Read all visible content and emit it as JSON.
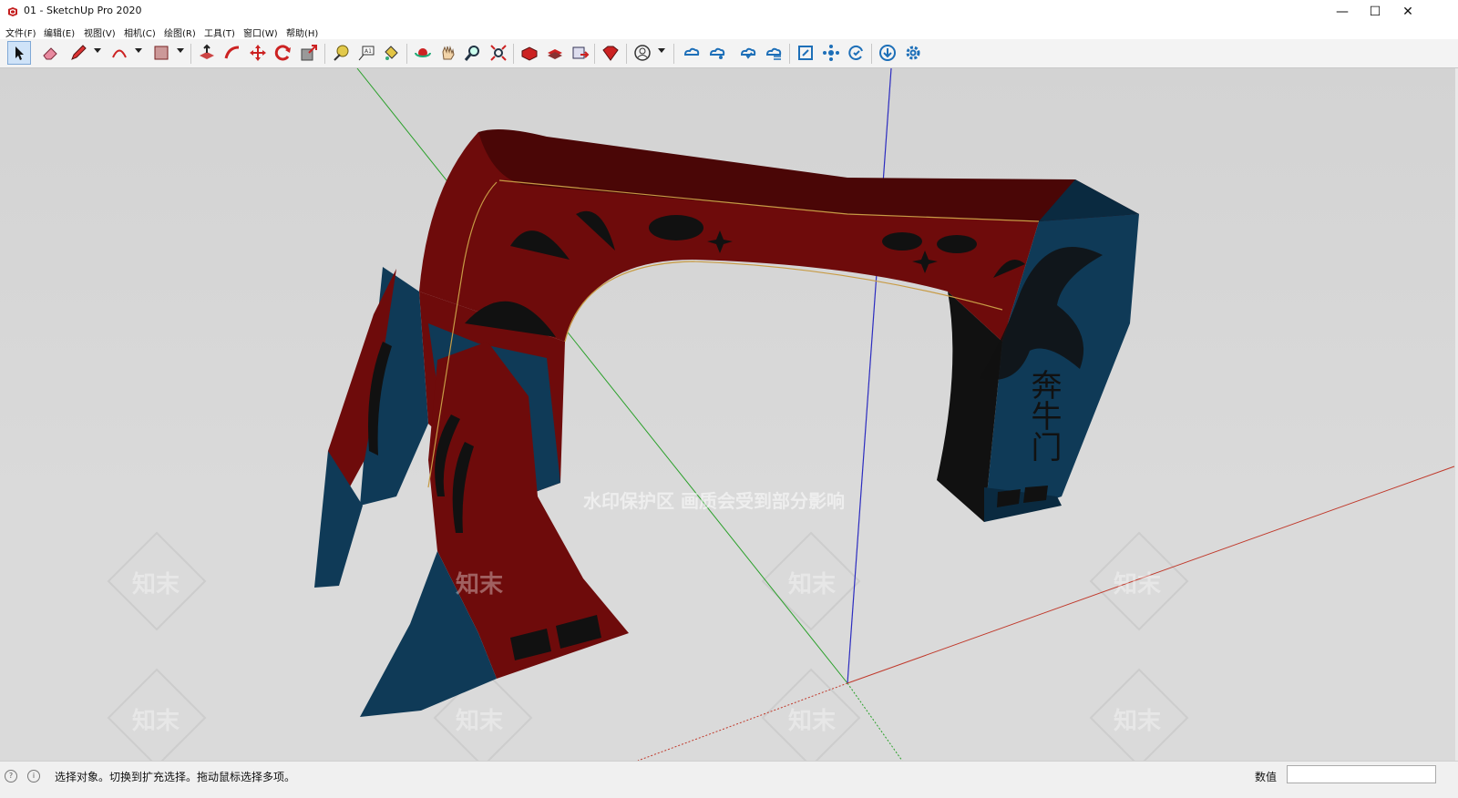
{
  "window": {
    "title": "01 - SketchUp Pro 2020",
    "controls": {
      "minimize": "—",
      "maximize": "☐",
      "close": "✕"
    }
  },
  "menu": [
    "文件(F)",
    "编辑(E)",
    "视图(V)",
    "相机(C)",
    "绘图(R)",
    "工具(T)",
    "窗口(W)",
    "帮助(H)"
  ],
  "toolbar": {
    "tools": [
      "select-tool",
      "eraser-tool",
      "line-tool",
      "arc-tool",
      "rectangle-tool",
      "push-pull-tool",
      "follow-me-tool",
      "move-tool",
      "rotate-tool",
      "scale-tool",
      "tape-measure-tool",
      "text-tool",
      "paint-bucket-tool",
      "orbit-tool",
      "pan-tool",
      "zoom-tool",
      "zoom-extents-tool",
      "warehouse-tool",
      "extension-warehouse-tool",
      "send-to-layout-tool",
      "extension-manager-tool",
      "account-tool",
      "cloud-sync-tool",
      "cloud-share-tool",
      "cloud-upload-tool",
      "cloud-list-tool",
      "zoom-window-tool",
      "components-tool",
      "refresh-tool",
      "download-tool",
      "settings-tool"
    ]
  },
  "viewport": {
    "model_text": "奔牛门",
    "watermark": {
      "notice": "水印保护区  画质会受到部分影响",
      "mark": "知末"
    },
    "colors": {
      "background_top": "#d5d5d5",
      "background_bottom": "#dcdcdc",
      "red_face": "#6e0b0b",
      "red_dark": "#4a0606",
      "blue_face": "#0f3a57",
      "blue_dark": "#0a2a40",
      "axis_red": "#c0392b",
      "axis_green": "#2aa02a",
      "axis_blue": "#2c2cc0"
    }
  },
  "status": {
    "message": "选择对象。切换到扩充选择。拖动鼠标选择多项。",
    "measurements_label": "数值",
    "measurements_value": ""
  }
}
